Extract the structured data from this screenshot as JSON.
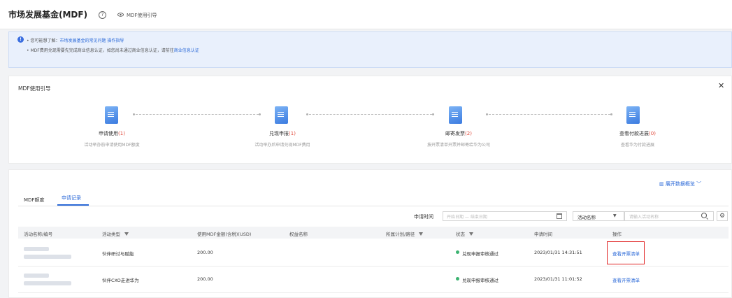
{
  "header": {
    "title": "市场发展基金(MDF)",
    "help_icon": "question-circle-icon",
    "guide_link": "MDF使用引导"
  },
  "notice": {
    "line1_prefix": "• 您可能想了解：",
    "line1_link1": "市场发展基金的常见问题",
    "line1_link2": "操作指导",
    "line2_prefix": "• MDF费用兑现需要先完成商业信息认证，如您尚未通过商业信息认证，请前往",
    "line2_link": "商业信息认证"
  },
  "guide": {
    "title": "MDF使用引导",
    "steps": [
      {
        "label": "申请使用",
        "count": "(1)",
        "desc": "活动举办前申请使用MDF额度"
      },
      {
        "label": "兑现申报",
        "count": "(1)",
        "desc": "活动举办后申请兑现MDF费用"
      },
      {
        "label": "邮寄发票",
        "count": "(2)",
        "desc": "按开票清单开票并邮寄给华为公司"
      },
      {
        "label": "查看付款进展",
        "count": "(0)",
        "desc": "查看华为付款进展"
      }
    ]
  },
  "records": {
    "expand_label": "展开数据概览",
    "tabs": [
      "MDF额度",
      "申请记录"
    ],
    "active_tab": "申请记录",
    "filters": {
      "time_label": "申请时间",
      "date_placeholder": "开始日期 — 结束日期",
      "select_value": "活动名称",
      "search_placeholder": "请输入活动名称"
    },
    "columns": [
      "活动名称/编号",
      "活动类型",
      "使用MDF金额(含税)(USD)",
      "权益名称",
      "所属计划/路径",
      "状态",
      "申请时间",
      "操作"
    ],
    "rows": [
      {
        "type": "伙伴研讨与赋能",
        "amount": "200.00",
        "status": "兑现申报审核通过",
        "time": "2023/01/31 14:31:51",
        "action": "查看开票清单"
      },
      {
        "type": "伙伴CXO走进华为",
        "amount": "200.00",
        "status": "兑现申报审核通过",
        "time": "2023/01/31 11:01:52",
        "action": "查看开票清单"
      }
    ]
  },
  "colors": {
    "accent": "#2c6ad8",
    "count_red": "#e14a3b",
    "status_green": "#3cb371",
    "highlight_red": "#e02020"
  }
}
